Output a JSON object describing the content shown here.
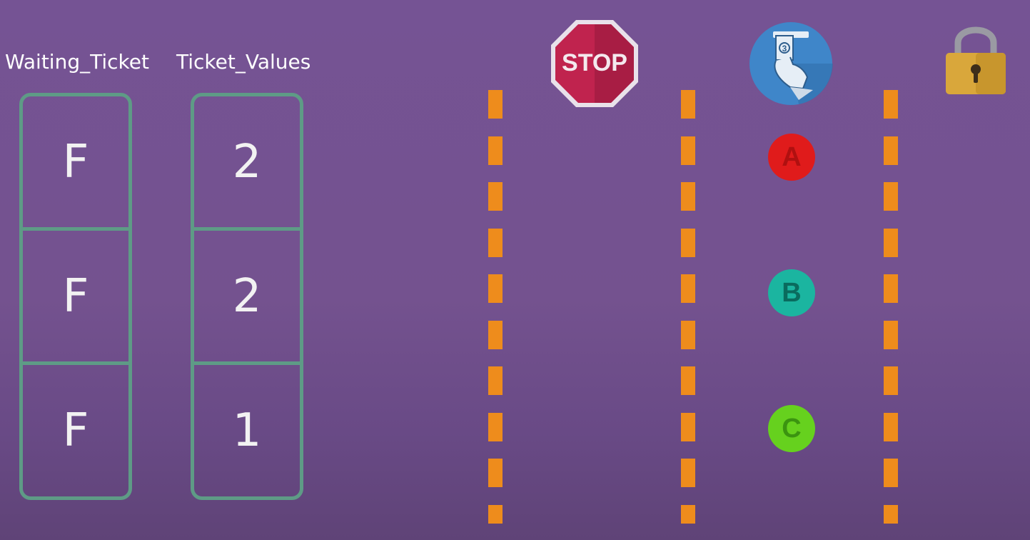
{
  "waiting_ticket": {
    "title": "Waiting_Ticket",
    "values": [
      "F",
      "F",
      "F"
    ]
  },
  "ticket_values": {
    "title": "Ticket_Values",
    "values": [
      "2",
      "2",
      "1"
    ]
  },
  "icons": {
    "stop": {
      "name": "stop-sign-icon",
      "label": "STOP",
      "color": "#c0234e"
    },
    "ticket": {
      "name": "ticket-dispenser-icon",
      "ticket_number": "3",
      "color": "#3f86c9"
    },
    "lock": {
      "name": "padlock-icon",
      "color": "#d9a73b"
    }
  },
  "threads": [
    {
      "label": "A",
      "color": "#e01b1b",
      "text_color": "#b01010"
    },
    {
      "label": "B",
      "color": "#1bb5a0",
      "text_color": "#0a6b5e"
    },
    {
      "label": "C",
      "color": "#66d11e",
      "text_color": "#3b9410"
    }
  ],
  "colors": {
    "background": "#755394",
    "box_border": "#5e9b86",
    "lane_dash": "#ee8c1c"
  }
}
